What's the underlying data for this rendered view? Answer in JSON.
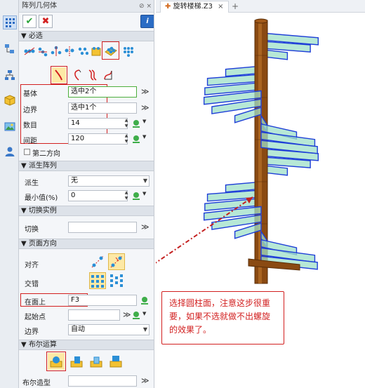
{
  "panel": {
    "title": "阵列几何体",
    "title_icons": "⊘ ×"
  },
  "tabs": [
    {
      "label": "旋转楼梯.Z3",
      "close": "×"
    }
  ],
  "new_tab": "+",
  "sections": {
    "required": "必选",
    "derive": "派生阵列",
    "switch_instance": "切换实例",
    "face_direction": "页面方向",
    "boolean": "布尔运算"
  },
  "fields": {
    "base": {
      "label": "基体",
      "value": "选中2个"
    },
    "boundary": {
      "label": "边界",
      "value": "选中1个"
    },
    "count": {
      "label": "数目",
      "value": "14"
    },
    "spacing": {
      "label": "间距",
      "value": "120"
    },
    "second_direction": {
      "label": "第二方向"
    },
    "derive": {
      "label": "派生",
      "value": "无"
    },
    "min_value": {
      "label": "最小值(%)",
      "value": "0"
    },
    "switch": {
      "label": "切换",
      "value": ""
    },
    "align": {
      "label": "对齐"
    },
    "stagger": {
      "label": "交错"
    },
    "on_face": {
      "label": "在面上",
      "value": "F3"
    },
    "start_point": {
      "label": "起始点",
      "value": ""
    },
    "boundary2": {
      "label": "边界",
      "value": "自动"
    },
    "boolean_shape": {
      "label": "布尔造型",
      "value": ""
    }
  },
  "callout": {
    "text": "选择圆柱面，注意这步很重要，如果不选就做不出螺旋的效果了。"
  },
  "colors": {
    "red": "#d21f1f",
    "step_fill": "#9fe0c8",
    "step_edge": "#1f3fd8",
    "pole": "#8a4a12"
  }
}
